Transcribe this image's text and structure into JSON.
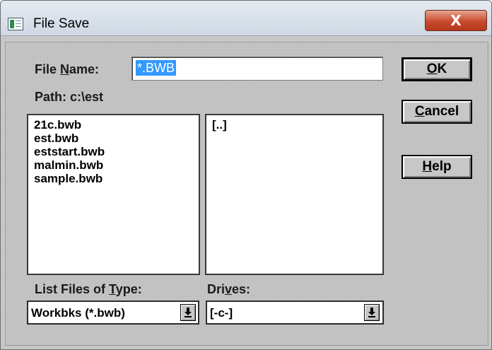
{
  "window": {
    "title": "File Save",
    "close_label": "X"
  },
  "file_name": {
    "label_pre": "File ",
    "label_key": "N",
    "label_post": "ame:",
    "value": "*.BWB"
  },
  "path": {
    "label": "Path:",
    "value": "c:\\est"
  },
  "files": [
    "21c.bwb",
    "est.bwb",
    "eststart.bwb",
    "malmin.bwb",
    "sample.bwb"
  ],
  "directories": [
    "[..]"
  ],
  "list_type": {
    "label_pre": "List Files of ",
    "label_key": "T",
    "label_post": "ype:",
    "value": "Workbks (*.bwb)"
  },
  "drives": {
    "label_pre": "Dri",
    "label_key": "v",
    "label_post": "es:",
    "value": "[-c-]"
  },
  "buttons": {
    "ok": {
      "key": "O",
      "rest": "K"
    },
    "cancel": {
      "key": "C",
      "rest": "ancel"
    },
    "help": {
      "key": "H",
      "rest": "elp"
    }
  },
  "icons": {
    "app": "app-icon",
    "close": "close-icon",
    "dropdown": "dropdown-arrow-icon"
  }
}
